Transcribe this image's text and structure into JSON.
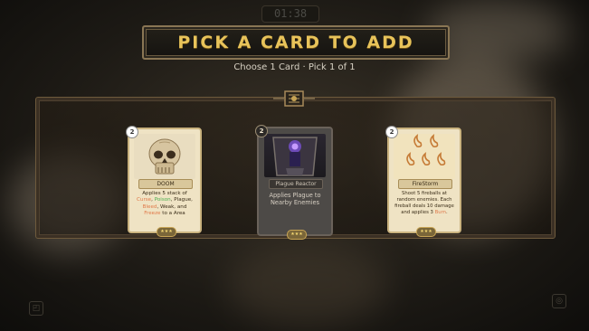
{
  "timer": "01:38",
  "title": "PICK A CARD TO ADD",
  "subtitle": "Choose 1 Card · Pick 1 of 1",
  "cards": [
    {
      "cost": "2",
      "name": "DOOM",
      "art": "skull",
      "desc_parts": [
        {
          "text": "Applies 5 stack of "
        },
        {
          "text": "Curse",
          "color": "#e07a4a"
        },
        {
          "text": ", "
        },
        {
          "text": "Poison",
          "color": "#4caf50"
        },
        {
          "text": ", Plague, "
        },
        {
          "text": "Bleed",
          "color": "#e07a4a"
        },
        {
          "text": ", Weak, and "
        },
        {
          "text": "Freeze",
          "color": "#e07a4a"
        },
        {
          "text": " to a Area"
        }
      ]
    },
    {
      "cost": "2",
      "name": "Plague Reactor",
      "art": "reactor",
      "desc_parts": [
        {
          "text": "Applies Plague to Nearby Enemies"
        }
      ]
    },
    {
      "cost": "2",
      "name": "FireStorm",
      "art": "fire",
      "desc_parts": [
        {
          "text": "Shoot 5 fireballs at random enemies. Each fireball deals 10 damage and applies 3 "
        },
        {
          "text": "Burn",
          "color": "#e07a4a"
        },
        {
          "text": "."
        }
      ]
    }
  ],
  "colors": {
    "title": "#e8c35a",
    "panel_border": "#6e5a3c",
    "card_bg": "#efe3c4",
    "dark_card_bg": "#4d4a47"
  }
}
